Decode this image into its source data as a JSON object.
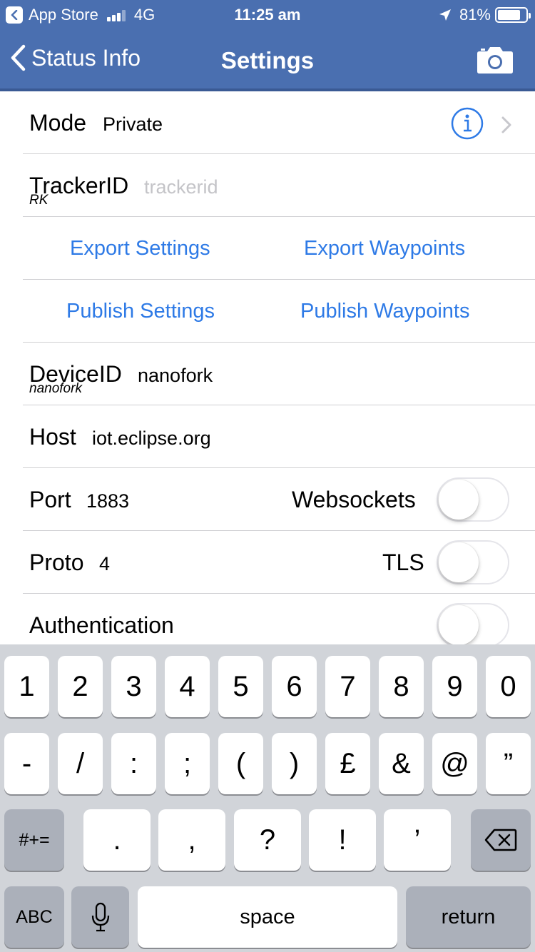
{
  "status_bar": {
    "back_app": "App Store",
    "network": "4G",
    "time": "11:25 am",
    "battery": "81%",
    "battery_level": 0.81
  },
  "nav": {
    "back_label": "Status Info",
    "title": "Settings",
    "camera_icon": "camera-icon"
  },
  "settings": {
    "mode": {
      "label": "Mode",
      "value": "Private"
    },
    "tracker": {
      "label": "TrackerID",
      "placeholder": "trackerid",
      "sub": "RK"
    },
    "export_settings": "Export Settings",
    "export_waypoints": "Export Waypoints",
    "publish_settings": "Publish Settings",
    "publish_waypoints": "Publish Waypoints",
    "device": {
      "label": "DeviceID",
      "value": "nanofork",
      "sub": "nanofork"
    },
    "host": {
      "label": "Host",
      "value": "iot.eclipse.org"
    },
    "port": {
      "label": "Port",
      "value": "1883",
      "toggle_label": "Websockets",
      "toggle_on": false
    },
    "proto": {
      "label": "Proto",
      "value": "4",
      "toggle_label": "TLS",
      "toggle_on": false
    },
    "auth": {
      "label": "Authentication",
      "toggle_on": false
    }
  },
  "keyboard": {
    "row1": [
      "1",
      "2",
      "3",
      "4",
      "5",
      "6",
      "7",
      "8",
      "9",
      "0"
    ],
    "row2": [
      "-",
      "/",
      ":",
      ";",
      "(",
      ")",
      "£",
      "&",
      "@",
      "”"
    ],
    "row3_mode": "#+=",
    "row3": [
      ".",
      ",",
      "?",
      "!",
      "’"
    ],
    "abc": "ABC",
    "space": "space",
    "return": "return"
  },
  "colors": {
    "nav_bar": "#4a6fb0",
    "link": "#2e7ae6",
    "keyboard_bg": "#d1d4d9"
  }
}
